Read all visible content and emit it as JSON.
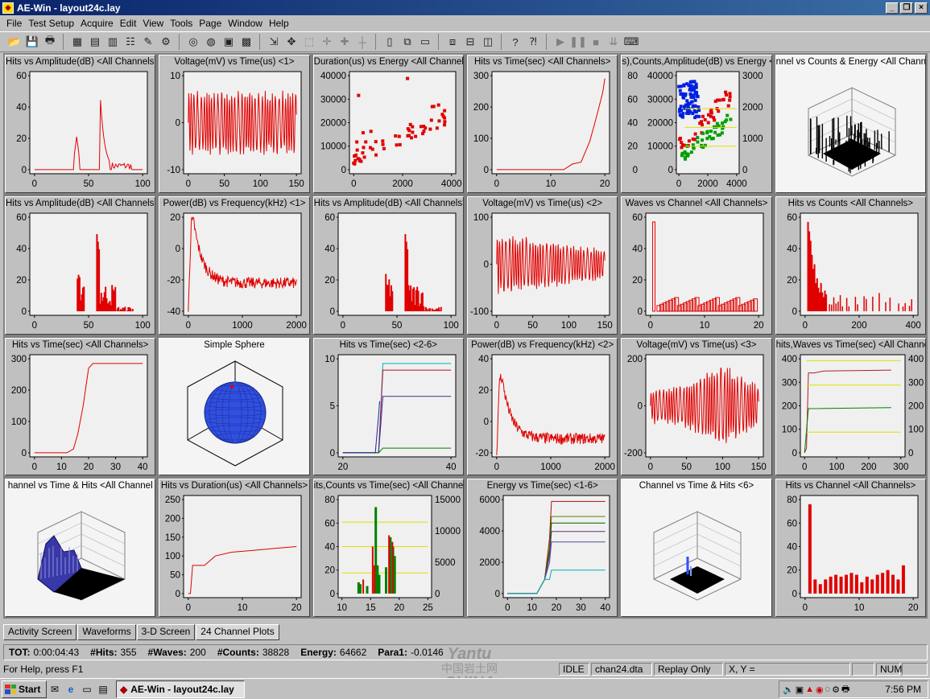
{
  "window": {
    "title": "AE-Win - layout24c.lay"
  },
  "menu": [
    "File",
    "Test Setup",
    "Acquire",
    "Edit",
    "View",
    "Tools",
    "Page",
    "Window",
    "Help"
  ],
  "toolbar": [
    {
      "icon": "open-icon",
      "g": "📂"
    },
    {
      "icon": "save-icon",
      "g": "💾"
    },
    {
      "icon": "print-icon",
      "g": "🖶"
    },
    {
      "sep": true
    },
    {
      "icon": "board-icon",
      "g": "▦"
    },
    {
      "icon": "layout-icon",
      "g": "▤"
    },
    {
      "icon": "graph-icon",
      "g": "▥"
    },
    {
      "icon": "channels-icon",
      "g": "☷"
    },
    {
      "icon": "filter-icon",
      "g": "✎"
    },
    {
      "icon": "tools-icon",
      "g": "⚙"
    },
    {
      "sep": true
    },
    {
      "icon": "target-icon",
      "g": "◎"
    },
    {
      "icon": "sphere-icon",
      "g": "◍"
    },
    {
      "icon": "monitor-icon",
      "g": "▣"
    },
    {
      "icon": "calendar-icon",
      "g": "▩"
    },
    {
      "sep": true
    },
    {
      "icon": "cursor-icon",
      "g": "⇲"
    },
    {
      "icon": "move-icon",
      "g": "✥"
    },
    {
      "icon": "zoom-box-icon",
      "g": "⬚",
      "dis": true
    },
    {
      "icon": "zoom-in-icon",
      "g": "✛",
      "dis": true
    },
    {
      "icon": "zoom-out-icon",
      "g": "✚",
      "dis": true
    },
    {
      "icon": "crosshair-icon",
      "g": "┼",
      "dis": true
    },
    {
      "sep": true
    },
    {
      "icon": "new-page-icon",
      "g": "▯"
    },
    {
      "icon": "copy-page-icon",
      "g": "⧉"
    },
    {
      "icon": "page-icon",
      "g": "▭"
    },
    {
      "sep": true
    },
    {
      "icon": "cascade-icon",
      "g": "⧈"
    },
    {
      "icon": "tile-horizontal-icon",
      "g": "⊟"
    },
    {
      "icon": "tile-vertical-icon",
      "g": "◫"
    },
    {
      "sep": true
    },
    {
      "icon": "help-icon",
      "g": "?"
    },
    {
      "icon": "context-help-icon",
      "g": "⁈"
    },
    {
      "sep": true
    },
    {
      "icon": "play-icon",
      "g": "▶",
      "dis": true
    },
    {
      "icon": "pause-icon",
      "g": "❚❚",
      "dis": true
    },
    {
      "icon": "stop-icon",
      "g": "■",
      "dis": true
    },
    {
      "icon": "step-icon",
      "g": "⇊",
      "dis": true
    },
    {
      "icon": "keyboard-icon",
      "g": "⌨"
    }
  ],
  "panels": [
    {
      "title": "Hits vs Amplitude(dB) <All Channels>",
      "kind": "plot",
      "shape": "amp1",
      "x": [
        "0",
        "50",
        "100"
      ],
      "y": [
        "0",
        "20",
        "40",
        "60"
      ]
    },
    {
      "title": "Voltage(mV) vs Time(us) <1>",
      "kind": "plot",
      "shape": "wave1",
      "x": [
        "0",
        "50",
        "100",
        "150"
      ],
      "y": [
        "-10",
        "0",
        "10"
      ]
    },
    {
      "title": "Duration(us) vs Energy <All Channels>",
      "kind": "plot",
      "shape": "scatter",
      "x": [
        "0",
        "2000",
        "4000"
      ],
      "y": [
        "0",
        "10000",
        "20000",
        "30000",
        "40000"
      ]
    },
    {
      "title": "Hits vs Time(sec) <All Channels>",
      "kind": "plot",
      "shape": "cum1",
      "x": [
        "0",
        "10",
        "20"
      ],
      "y": [
        "0",
        "100",
        "200",
        "300"
      ]
    },
    {
      "title": "s),Counts,Amplitude(dB) vs Energy <All",
      "kind": "plot",
      "shape": "multi",
      "x": [
        "0",
        "2000",
        "4000"
      ],
      "y": [
        "0",
        "10000",
        "20000",
        "30000",
        "40000"
      ],
      "y_left2": [
        "0",
        "20",
        "40",
        "60",
        "80"
      ],
      "y_right": [
        "0",
        "1000",
        "2000",
        "3000"
      ]
    },
    {
      "title": "nnel vs Counts & Energy <All Chann",
      "kind": "3d",
      "shape": "3d1"
    },
    {
      "title": "Hits vs Amplitude(dB) <All Channels>",
      "kind": "plot",
      "shape": "amp2",
      "x": [
        "0",
        "50",
        "100"
      ],
      "y": [
        "0",
        "20",
        "40",
        "60"
      ]
    },
    {
      "title": "Power(dB) vs Frequency(kHz) <1>",
      "kind": "plot",
      "shape": "power1",
      "x": [
        "0",
        "1000",
        "2000"
      ],
      "y": [
        "-40",
        "-20",
        "0",
        "20"
      ]
    },
    {
      "title": "Hits vs Amplitude(dB) <All Channels>",
      "kind": "plot",
      "shape": "amp2",
      "x": [
        "0",
        "50",
        "100"
      ],
      "y": [
        "0",
        "20",
        "40",
        "60"
      ]
    },
    {
      "title": "Voltage(mV) vs Time(us) <2>",
      "kind": "plot",
      "shape": "wave2",
      "x": [
        "0",
        "50",
        "100",
        "150"
      ],
      "y": [
        "-100",
        "0",
        "100"
      ]
    },
    {
      "title": "Waves vs Channel <All Channels>",
      "kind": "plot",
      "shape": "waves",
      "x": [
        "0",
        "10",
        "20"
      ],
      "y": [
        "0",
        "20",
        "40",
        "60"
      ]
    },
    {
      "title": "Hits vs Counts <All Channels>",
      "kind": "plot",
      "shape": "counts",
      "x": [
        "0",
        "200",
        "400"
      ],
      "y": [
        "0",
        "20",
        "40",
        "60"
      ]
    },
    {
      "title": "Hits vs Time(sec) <All Channels>",
      "kind": "plot",
      "shape": "cum2",
      "x": [
        "0",
        "10",
        "20",
        "30",
        "40"
      ],
      "y": [
        "0",
        "100",
        "200",
        "300"
      ]
    },
    {
      "title": "Simple Sphere",
      "kind": "sphere",
      "shape": "sphere"
    },
    {
      "title": "Hits vs Time(sec) <2-6>",
      "kind": "plot",
      "shape": "steps",
      "x": [
        "20",
        "40"
      ],
      "y": [
        "0",
        "5",
        "10"
      ]
    },
    {
      "title": "Power(dB) vs Frequency(kHz) <2>",
      "kind": "plot",
      "shape": "power2",
      "x": [
        "0",
        "1000",
        "2000"
      ],
      "y": [
        "-20",
        "0",
        "20",
        "40"
      ]
    },
    {
      "title": "Voltage(mV) vs Time(us) <3>",
      "kind": "plot",
      "shape": "wave3",
      "x": [
        "0",
        "50",
        "100",
        "150"
      ],
      "y": [
        "-200",
        "0",
        "200"
      ]
    },
    {
      "title": "hits,Waves vs Time(sec) <All Channels",
      "kind": "plot",
      "shape": "hitswaves",
      "x": [
        "0",
        "100",
        "200",
        "300"
      ],
      "y": [
        "0",
        "100",
        "200",
        "300",
        "400"
      ],
      "y_right": [
        "0",
        "100",
        "200",
        "300",
        "400"
      ]
    },
    {
      "title": "hannel vs Time & Hits <All Channel",
      "kind": "3d",
      "shape": "3d2"
    },
    {
      "title": "Hits vs Duration(us) <All Channels>",
      "kind": "plot",
      "shape": "dur",
      "x": [
        "0",
        "10",
        "20"
      ],
      "y": [
        "0",
        "50",
        "100",
        "150",
        "200",
        "250"
      ]
    },
    {
      "title": "its,Counts vs Time(sec) <All Channels",
      "kind": "plot",
      "shape": "counts_time",
      "x": [
        "10",
        "15",
        "20",
        "25"
      ],
      "y": [
        "0",
        "20",
        "40",
        "60",
        "80"
      ],
      "y_right": [
        "0",
        "5000",
        "10000",
        "15000"
      ]
    },
    {
      "title": "Energy vs Time(sec) <1-6>",
      "kind": "plot",
      "shape": "energy",
      "x": [
        "0",
        "10",
        "20",
        "30",
        "40"
      ],
      "y": [
        "0",
        "2000",
        "4000",
        "6000"
      ]
    },
    {
      "title": "Channel vs Time & Hits <6>",
      "kind": "3d",
      "shape": "3d3"
    },
    {
      "title": "Hits vs Channel <All Channels>",
      "kind": "plot",
      "shape": "hitsch",
      "x": [
        "0",
        "10",
        "20"
      ],
      "y": [
        "0",
        "20",
        "40",
        "60",
        "80"
      ]
    }
  ],
  "tabs": [
    "Activity Screen",
    "Waveforms",
    "3-D Screen",
    "24 Channel Plots"
  ],
  "active_tab": 3,
  "stats": [
    {
      "label": "TOT:",
      "value": "0:00:04:43"
    },
    {
      "label": "#Hits:",
      "value": "355"
    },
    {
      "label": "#Waves:",
      "value": "200"
    },
    {
      "label": "#Counts:",
      "value": "38828"
    },
    {
      "label": "Energy:",
      "value": "64662"
    },
    {
      "label": "Para1:",
      "value": "-0.0146"
    }
  ],
  "status": {
    "help": "For Help, press F1",
    "state": "IDLE",
    "file": "chan24.dta",
    "mode": "Replay Only",
    "xy": "X, Y =",
    "num": "NUM"
  },
  "taskbar": {
    "start": "Start",
    "task": "AE-Win - layout24c.lay",
    "clock": "7:56 PM"
  },
  "watermark": {
    "line1": "Yantu",
    "line2": "中国岩土网",
    "line3": "CHINA"
  },
  "colors": {
    "titlebar": "#0a246a",
    "plot_bg": "#f0f0f0",
    "trace": "#e00000",
    "blue": "#0000e0",
    "green": "#008000",
    "yellow": "#e0e000"
  }
}
